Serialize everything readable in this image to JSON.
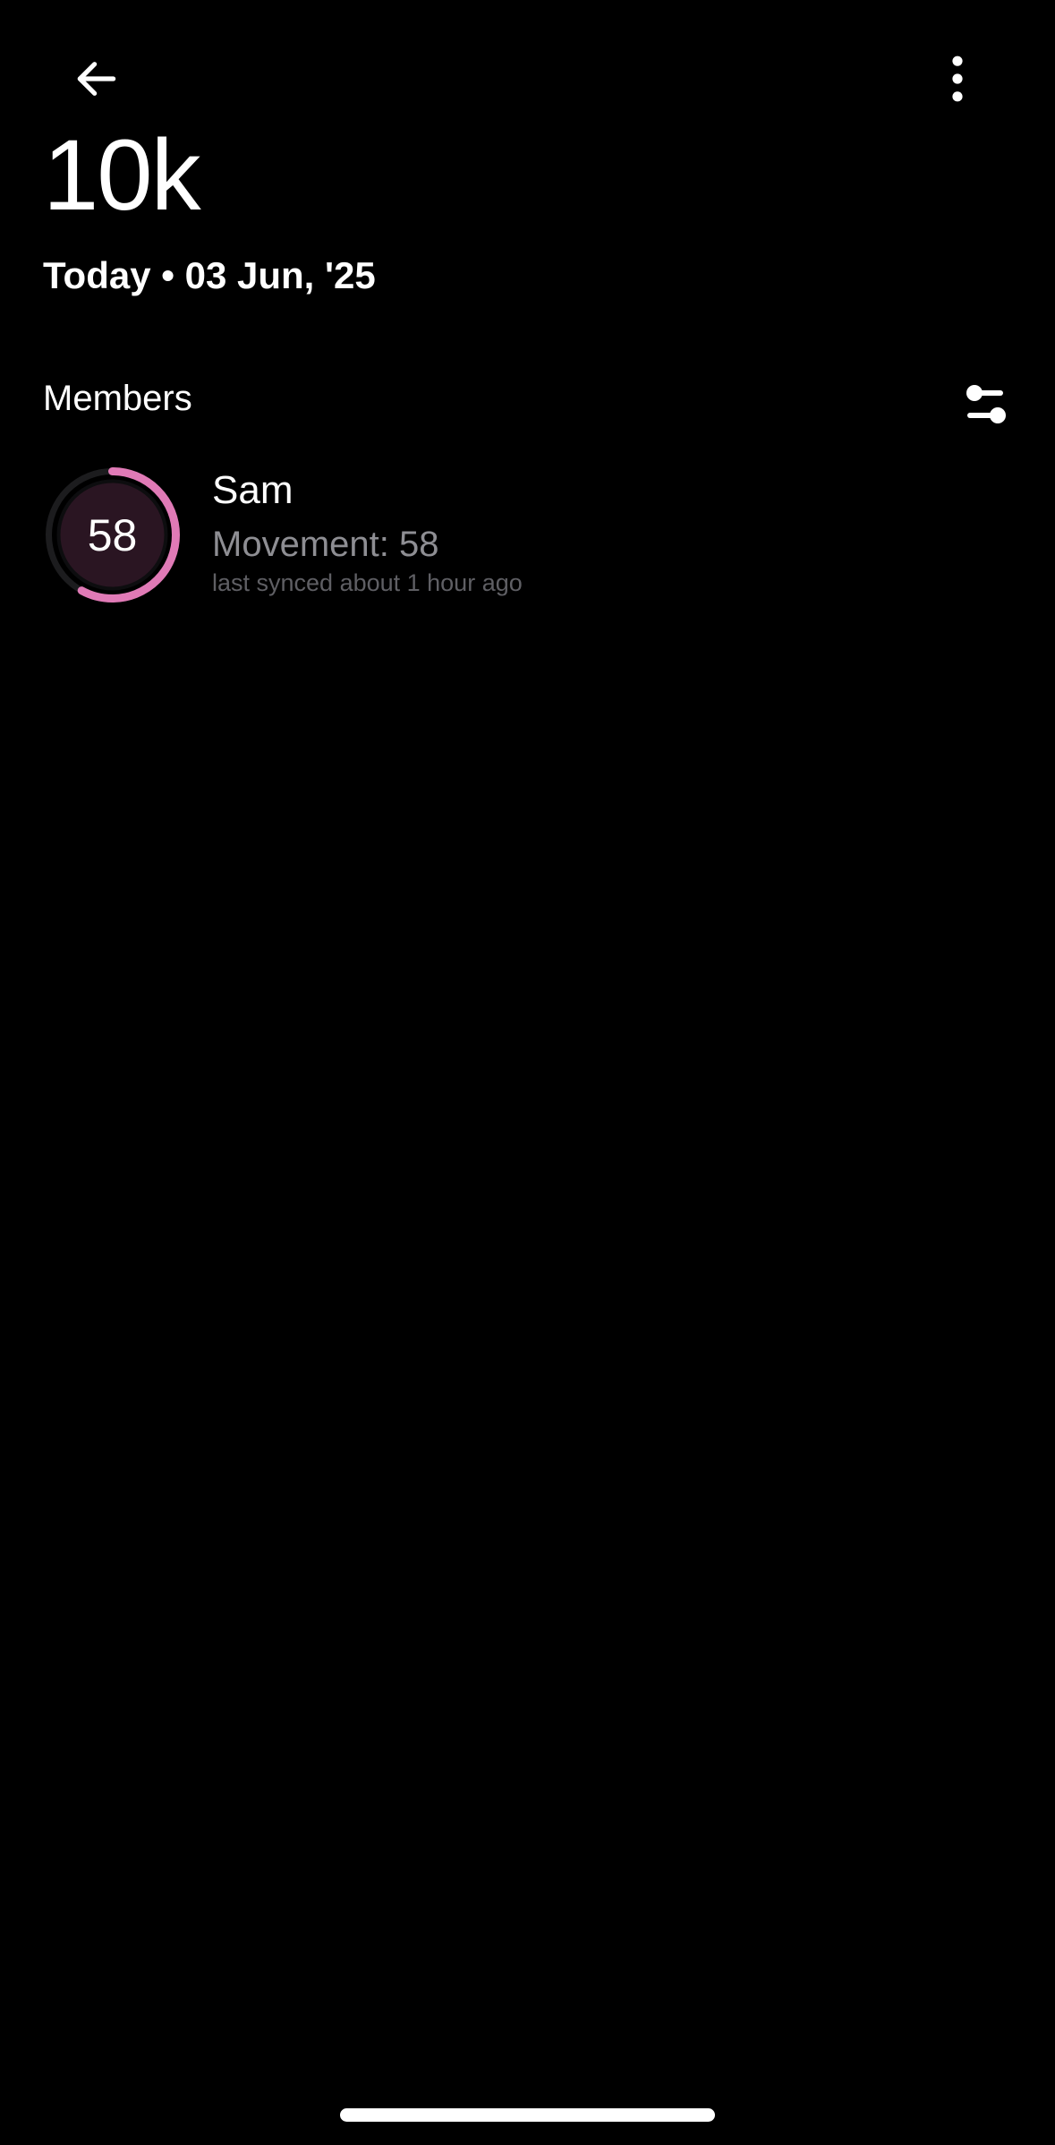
{
  "header": {
    "goal_title": "10k",
    "date_label": "Today • 03 Jun, '25"
  },
  "members": {
    "heading": "Members",
    "items": [
      {
        "name": "Sam",
        "score": "58",
        "score_fraction": 0.58,
        "metric": "Movement: 58",
        "sync_status": "last synced about 1 hour ago"
      }
    ]
  },
  "icons": {
    "back": "arrow-left-icon",
    "more": "more-vertical-icon",
    "filter": "sliders-icon"
  },
  "colors": {
    "background": "#000000",
    "ring_progress": "#e07ab6",
    "ring_track": "#1c1c1e",
    "ring_fill": "#2a1522",
    "secondary_text": "#8e8e93",
    "tertiary_text": "#5f5f64"
  }
}
